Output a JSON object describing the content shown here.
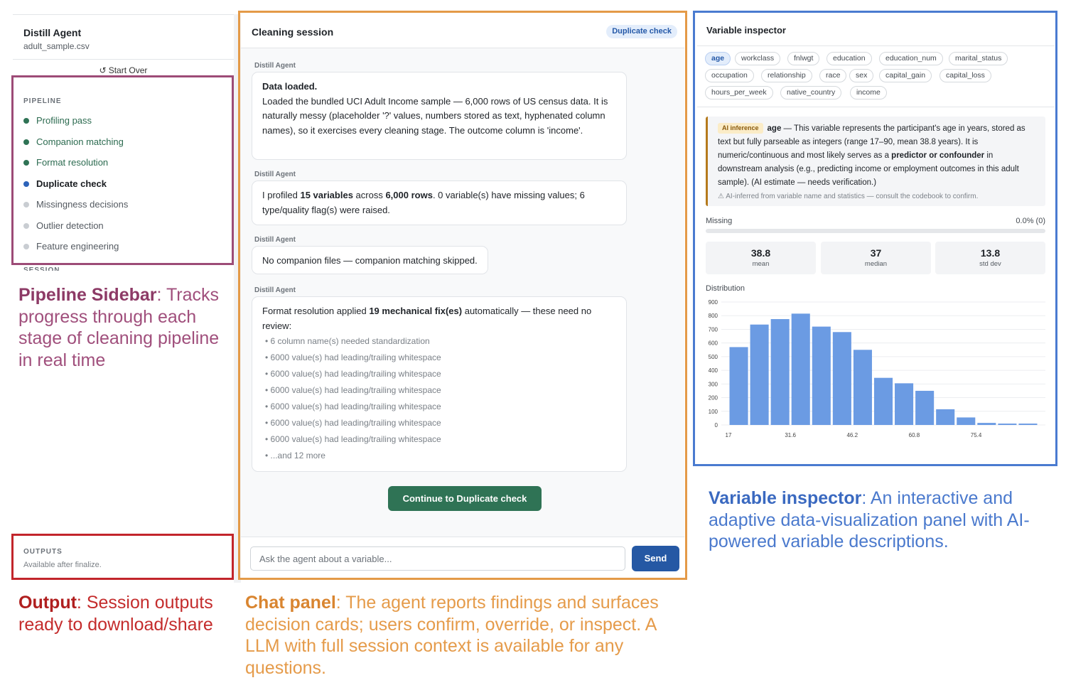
{
  "sidebar": {
    "app_title": "Distill Agent",
    "file_name": "adult_sample.csv",
    "start_over_label": "Start Over",
    "pipeline_label": "PIPELINE",
    "stages": [
      {
        "label": "Profiling pass",
        "status": "done"
      },
      {
        "label": "Companion matching",
        "status": "done"
      },
      {
        "label": "Format resolution",
        "status": "done"
      },
      {
        "label": "Duplicate check",
        "status": "active"
      },
      {
        "label": "Missingness decisions",
        "status": "pending"
      },
      {
        "label": "Outlier detection",
        "status": "pending"
      },
      {
        "label": "Feature engineering",
        "status": "pending"
      }
    ],
    "session_label": "SESSION",
    "outputs_label": "OUTPUTS",
    "outputs_note": "Available after finalize."
  },
  "chat": {
    "title": "Cleaning session",
    "stage_badge": "Duplicate check",
    "author": "Distill Agent",
    "msg1": {
      "title": "Data loaded.",
      "body": "Loaded the bundled UCI Adult Income sample — 6,000 rows of US census data. It is naturally messy (placeholder '?' values, numbers stored as text, hyphenated column names), so it exercises every cleaning stage. The outcome column is 'income'."
    },
    "msg2": {
      "p1": "I profiled ",
      "b1": "15 variables",
      "p2": " across ",
      "b2": "6,000 rows",
      "p3": ". 0 variable(s) have missing values; 6 type/quality flag(s) were raised."
    },
    "msg3": {
      "body": "No companion files — companion matching skipped."
    },
    "msg4": {
      "p1": "Format resolution applied ",
      "b1": "19 mechanical fix(es)",
      "p2": " automatically — these need no review:",
      "items": [
        "• 6 column name(s) needed standardization",
        "• 6000 value(s) had leading/trailing whitespace",
        "• 6000 value(s) had leading/trailing whitespace",
        "• 6000 value(s) had leading/trailing whitespace",
        "• 6000 value(s) had leading/trailing whitespace",
        "• 6000 value(s) had leading/trailing whitespace",
        "• 6000 value(s) had leading/trailing whitespace",
        "• ...and 12 more"
      ]
    },
    "continue_label": "Continue to Duplicate check",
    "input_placeholder": "Ask the agent about a variable...",
    "send_label": "Send"
  },
  "inspector": {
    "title": "Variable inspector",
    "variables": [
      "age",
      "workclass",
      "fnlwgt",
      "education",
      "education_num",
      "marital_status",
      "occupation",
      "relationship",
      "race",
      "sex",
      "capital_gain",
      "capital_loss",
      "hours_per_week",
      "native_country",
      "income"
    ],
    "selected": "age",
    "ai": {
      "badge": "AI inference",
      "var": "age",
      "t1": " — This variable represents the participant's age in years, stored as text but fully parseable as integers (range 17–90, mean 38.8 years). It is numeric/continuous and most likely serves as a ",
      "bold": "predictor or confounder",
      "t2": " in downstream analysis (e.g., predicting income or employment outcomes in this adult sample). (AI estimate — needs verification.)",
      "note": "⚠ AI-inferred from variable name and statistics — consult the codebook to confirm."
    },
    "missing_label": "Missing",
    "missing_value": "0.0% (0)",
    "missing_fraction": 0,
    "stats": [
      {
        "value": "38.8",
        "label": "mean"
      },
      {
        "value": "37",
        "label": "median"
      },
      {
        "value": "13.8",
        "label": "std dev"
      }
    ],
    "distribution_label": "Distribution"
  },
  "chart_data": {
    "type": "bar",
    "title": "",
    "xlabel": "",
    "ylabel": "",
    "x_min": 17,
    "x_max": 90,
    "bin_width": 4.87,
    "values": [
      570,
      735,
      775,
      815,
      720,
      680,
      550,
      345,
      305,
      250,
      115,
      55,
      15,
      10,
      10
    ],
    "ylim": [
      0,
      900
    ],
    "yticks": [
      0,
      100,
      200,
      300,
      400,
      500,
      600,
      700,
      800,
      900
    ],
    "xticks": [
      17,
      31.6,
      46.2,
      60.8,
      75.4
    ],
    "bar_color": "#6b9be3",
    "grid": true
  },
  "captions": {
    "pipeline": {
      "bold": "Pipeline Sidebar",
      "rest": ": Tracks progress through each stage of cleaning pipeline in real time"
    },
    "outputs": {
      "bold": "Output",
      "rest": ": Session outputs ready to download/share"
    },
    "chat": {
      "bold": "Chat panel",
      "rest": ": The agent reports findings and surfaces decision cards; users confirm, override, or inspect. A LLM with full session context is available for any questions."
    },
    "inspector": {
      "bold": "Variable inspector",
      "rest": ": An interactive and adaptive data-visualization panel with AI-powered variable descriptions."
    }
  },
  "colors": {
    "done": "#2f7355",
    "active": "#2d63b9",
    "pending": "#c9cdd2",
    "pipeline_outline": "#9d4b77",
    "outputs_outline": "#c2252b",
    "chat_outline": "#e49a48",
    "inspector_outline": "#4a7bd0"
  }
}
